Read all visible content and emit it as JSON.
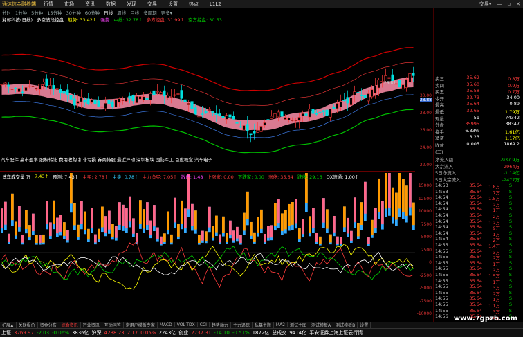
{
  "menubar": {
    "logo": "通达信金融终端",
    "items": [
      "行情",
      "市场",
      "资讯",
      "数据",
      "发现",
      "交易",
      "设置",
      "热点",
      "L1L2"
    ],
    "right": [
      "交易▾",
      "—",
      "▫",
      "✕"
    ]
  },
  "timeframes": [
    "分时",
    "1分钟",
    "5分钟",
    "15分钟",
    "30分钟",
    "60分钟",
    "日线",
    "周线",
    "月线",
    "多周期",
    "更多▾"
  ],
  "selected_tf": "日线",
  "infobar": [
    {
      "t": "湘邮科技(日线)",
      "c": "white"
    },
    {
      "t": "多空波段控盘",
      "c": "white"
    },
    {
      "t": "趋势: 33.42↑",
      "c": "yellow"
    },
    {
      "t": "强势",
      "c": "mag"
    },
    {
      "t": "中线: 32.78↑",
      "c": "green"
    },
    {
      "t": "多方控盘: 31.99↑",
      "c": "red"
    },
    {
      "t": "空方控盘: 30.53",
      "c": "green"
    }
  ],
  "banner": [
    "汽车配件",
    "高市盈率",
    "股权转让",
    "费用收购",
    "扣非亏损",
    "券商持股",
    "最近异动",
    "深圳板块",
    "国防军工",
    "百度概念",
    "汽车电子"
  ],
  "volinfo": [
    {
      "t": "博弈成交量 万",
      "c": "white"
    },
    {
      "t": "7.43↑",
      "c": "yellow"
    },
    {
      "t": "预测: 7.43↑",
      "c": "white"
    },
    {
      "t": "主买: 2.78↑",
      "c": "red"
    },
    {
      "t": "主卖: 0.78↑",
      "c": "cyan"
    },
    {
      "t": "主力净买: 7.05↑",
      "c": "red"
    },
    {
      "t": "散户: 1.48",
      "c": "mag"
    },
    {
      "t": "上涨家: 0.00",
      "c": "red"
    },
    {
      "t": "下跌家: 0.00",
      "c": "green"
    },
    {
      "t": "涨停: 35.64",
      "c": "red"
    },
    {
      "t": "跌停: 29.16",
      "c": "green"
    },
    {
      "t": "DX流通: 1.00↑",
      "c": "white"
    }
  ],
  "price_ticks": [
    "30.00",
    "28.00",
    "26.00",
    "24.00",
    "22.00"
  ],
  "vol_ticks": [
    "15000",
    "12500",
    "10000",
    "7500",
    "5000",
    "2500",
    "0",
    "-2500",
    "-5000",
    "-7500",
    "-10000"
  ],
  "current_price": "28.88",
  "price_note": "29.81",
  "quotes": [
    {
      "k": "卖三",
      "v1": "35.62",
      "v2": "0.8万",
      "c": "red"
    },
    {
      "k": "卖四",
      "v1": "35.60",
      "v2": "0.9万",
      "c": "red"
    },
    {
      "k": "买五",
      "v1": "35.58",
      "v2": "0.7万",
      "c": "red"
    },
    {
      "k": "今开",
      "v1": "32.73",
      "v2": "34.00",
      "c": "red",
      "lk2": "总额"
    },
    {
      "k": "最高",
      "v1": "35.64",
      "v2": "0.89",
      "c": "red",
      "lk2": "量比"
    },
    {
      "k": "最低",
      "v1": "32.65",
      "v2": "1.79万",
      "c": "red",
      "lk2": "外盘"
    },
    {
      "k": "现量",
      "v1": "51",
      "v2": "74342",
      "c": "white",
      "lk2": "内盘"
    },
    {
      "k": "外盘",
      "v1": "35995",
      "v2": "38347",
      "c": "red",
      "lk2": "内盘"
    },
    {
      "k": "换手",
      "v1": "6.33%",
      "v2": "1.61亿",
      "c": "white",
      "lk2": "股本"
    },
    {
      "k": "净资",
      "v1": "3.23",
      "v2": "1.17亿",
      "c": "white",
      "lk2": "流通"
    },
    {
      "k": "收益(二)",
      "v1": "0.005",
      "v2": "1869.2",
      "c": "white",
      "lk2": "PE(动)"
    }
  ],
  "flows": [
    {
      "k": "净流入额",
      "v": "-937.9万",
      "c": "green"
    },
    {
      "k": "大宗流入",
      "v": "2964万",
      "c": "red"
    },
    {
      "k": "5日净流入",
      "v": "-1.14亿",
      "c": "green"
    },
    {
      "k": "5日大宗流入",
      "v": "-2477万",
      "c": "green"
    }
  ],
  "ticks": [
    {
      "t": "14:53",
      "p": "35.64",
      "q": "1.8万",
      "s": "S"
    },
    {
      "t": "14:53",
      "p": "35.64",
      "q": "7万",
      "s": "S"
    },
    {
      "t": "14:54",
      "p": "35.64",
      "q": "1.5万",
      "s": "S"
    },
    {
      "t": "14:54",
      "p": "35.64",
      "q": "2万",
      "s": "S"
    },
    {
      "t": "14:54",
      "p": "35.64",
      "q": "1万",
      "s": "S"
    },
    {
      "t": "14:54",
      "p": "35.64",
      "q": "2万",
      "s": "S"
    },
    {
      "t": "14:54",
      "p": "35.64",
      "q": "1.2万",
      "s": "S"
    },
    {
      "t": "14:54",
      "p": "35.64",
      "q": "9万",
      "s": "S"
    },
    {
      "t": "14:54",
      "p": "35.64",
      "q": "1万",
      "s": "S"
    },
    {
      "t": "14:54",
      "p": "35.64",
      "q": "2万",
      "s": "S"
    },
    {
      "t": "14:55",
      "p": "35.64",
      "q": "1.4万",
      "s": "S"
    },
    {
      "t": "14:55",
      "p": "35.64",
      "q": "3万",
      "s": "S"
    },
    {
      "t": "14:55",
      "p": "35.64",
      "q": "2万",
      "s": "S"
    },
    {
      "t": "14:55",
      "p": "35.64",
      "q": "1万",
      "s": "S"
    },
    {
      "t": "14:55",
      "p": "35.64",
      "q": "2万",
      "s": "S"
    },
    {
      "t": "14:55",
      "p": "35.64",
      "q": "1.5万",
      "s": "S"
    },
    {
      "t": "14:55",
      "p": "35.64",
      "q": "1万",
      "s": "S"
    },
    {
      "t": "14:55",
      "p": "35.64",
      "q": "3万",
      "s": "S"
    },
    {
      "t": "14:55",
      "p": "35.64",
      "q": "2万",
      "s": "S"
    },
    {
      "t": "14:55",
      "p": "35.64",
      "q": "1万",
      "s": "S"
    },
    {
      "t": "14:55",
      "p": "35.64",
      "q": "1.1万",
      "s": "S"
    },
    {
      "t": "14:55",
      "p": "35.64",
      "q": "3万",
      "s": "S"
    },
    {
      "t": "14:56",
      "p": "35.64",
      "q": "1.3万",
      "s": "S"
    }
  ],
  "datebar": [
    "2021年",
    "3",
    "5",
    "7",
    "2022/04/06/三",
    "9",
    "11",
    "1"
  ],
  "tabs": [
    "扩展▲",
    "关联报价",
    "资金分布",
    "综合资讯",
    "行业资讯",
    "互动问答",
    "常用户模板专家",
    "MACD",
    "VOL-TDX",
    "CCI",
    "趋势动力",
    "主力追踪",
    "私募主题",
    "MA2",
    "测试主图",
    "测试模板A",
    "测试模板B",
    "设置"
  ],
  "status": [
    {
      "t": "上证",
      "c": "white"
    },
    {
      "t": "3269.97",
      "c": "red"
    },
    {
      "t": "-2.03",
      "c": "green"
    },
    {
      "t": "-0.06%",
      "c": "green"
    },
    {
      "t": "3836亿",
      "c": "white"
    },
    {
      "t": "沪深",
      "c": "white"
    },
    {
      "t": "4238.23",
      "c": "red"
    },
    {
      "t": "2.17",
      "c": "red"
    },
    {
      "t": "0.05%",
      "c": "red"
    },
    {
      "t": "2243亿",
      "c": "white"
    },
    {
      "t": "创业",
      "c": "white"
    },
    {
      "t": "2737.31",
      "c": "red"
    },
    {
      "t": "-14.10",
      "c": "green"
    },
    {
      "t": "-0.51%",
      "c": "green"
    },
    {
      "t": "1872亿",
      "c": "white"
    },
    {
      "t": "总成交",
      "c": "white"
    },
    {
      "t": "9414亿",
      "c": "white"
    },
    {
      "t": "平安证券上海上证云行情",
      "c": "white"
    }
  ],
  "watermark": "www.7gpzb.com",
  "colors": {
    "up": "#ff3b3b",
    "down": "#00d000",
    "pink": "#ff7fa0",
    "blue": "#3399ff",
    "band": "#d00000"
  }
}
